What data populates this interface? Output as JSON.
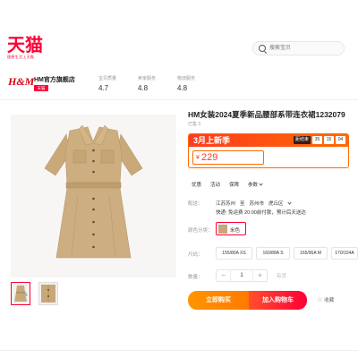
{
  "header": {
    "logo_text": "天猫",
    "logo_subtext": "理想生活上天猫",
    "search_placeholder": "搜索宝贝"
  },
  "shop": {
    "logo": "H&M",
    "name": "HM官方旗舰店",
    "badge": "天猫",
    "stats": [
      {
        "label": "宝贝质量",
        "value": "4.7"
      },
      {
        "label": "卖家服务",
        "value": "4.8"
      },
      {
        "label": "物流服务",
        "value": "4.8"
      }
    ]
  },
  "product": {
    "title": "HM女装2024夏季新品腰部系带连衣裙1232079",
    "sold": "已售 3",
    "promo_tag": "3月上新季",
    "countdown_label": "距结束",
    "countdown": [
      "35",
      "15",
      "04"
    ],
    "currency": "¥",
    "price": "229",
    "tabs": [
      "优惠",
      "活动",
      "保障",
      "参数"
    ],
    "shipping_label": "配送：",
    "shipping_from": "江苏苏州",
    "shipping_to_word": "至",
    "shipping_city": "苏州市",
    "shipping_district": "虎丘区",
    "shipping_note": "快递: 免运费  20:00前付款，预计后天送达",
    "color_label": "颜色分类：",
    "color_option": "米色",
    "size_label": "尺码：",
    "sizes": [
      "155/80A XS",
      "160/88A S",
      "165/96A M",
      "170/104A"
    ],
    "qty_label": "数量：",
    "qty_minus": "−",
    "qty_value": "1",
    "qty_plus": "+",
    "qty_extra": "有货",
    "buy_label": "立即购买",
    "cart_label": "加入购物车",
    "fav_label": "收藏"
  },
  "colors": {
    "brand": "#ff0036",
    "orange": "#ff6a00",
    "dress": "#c8a878"
  }
}
